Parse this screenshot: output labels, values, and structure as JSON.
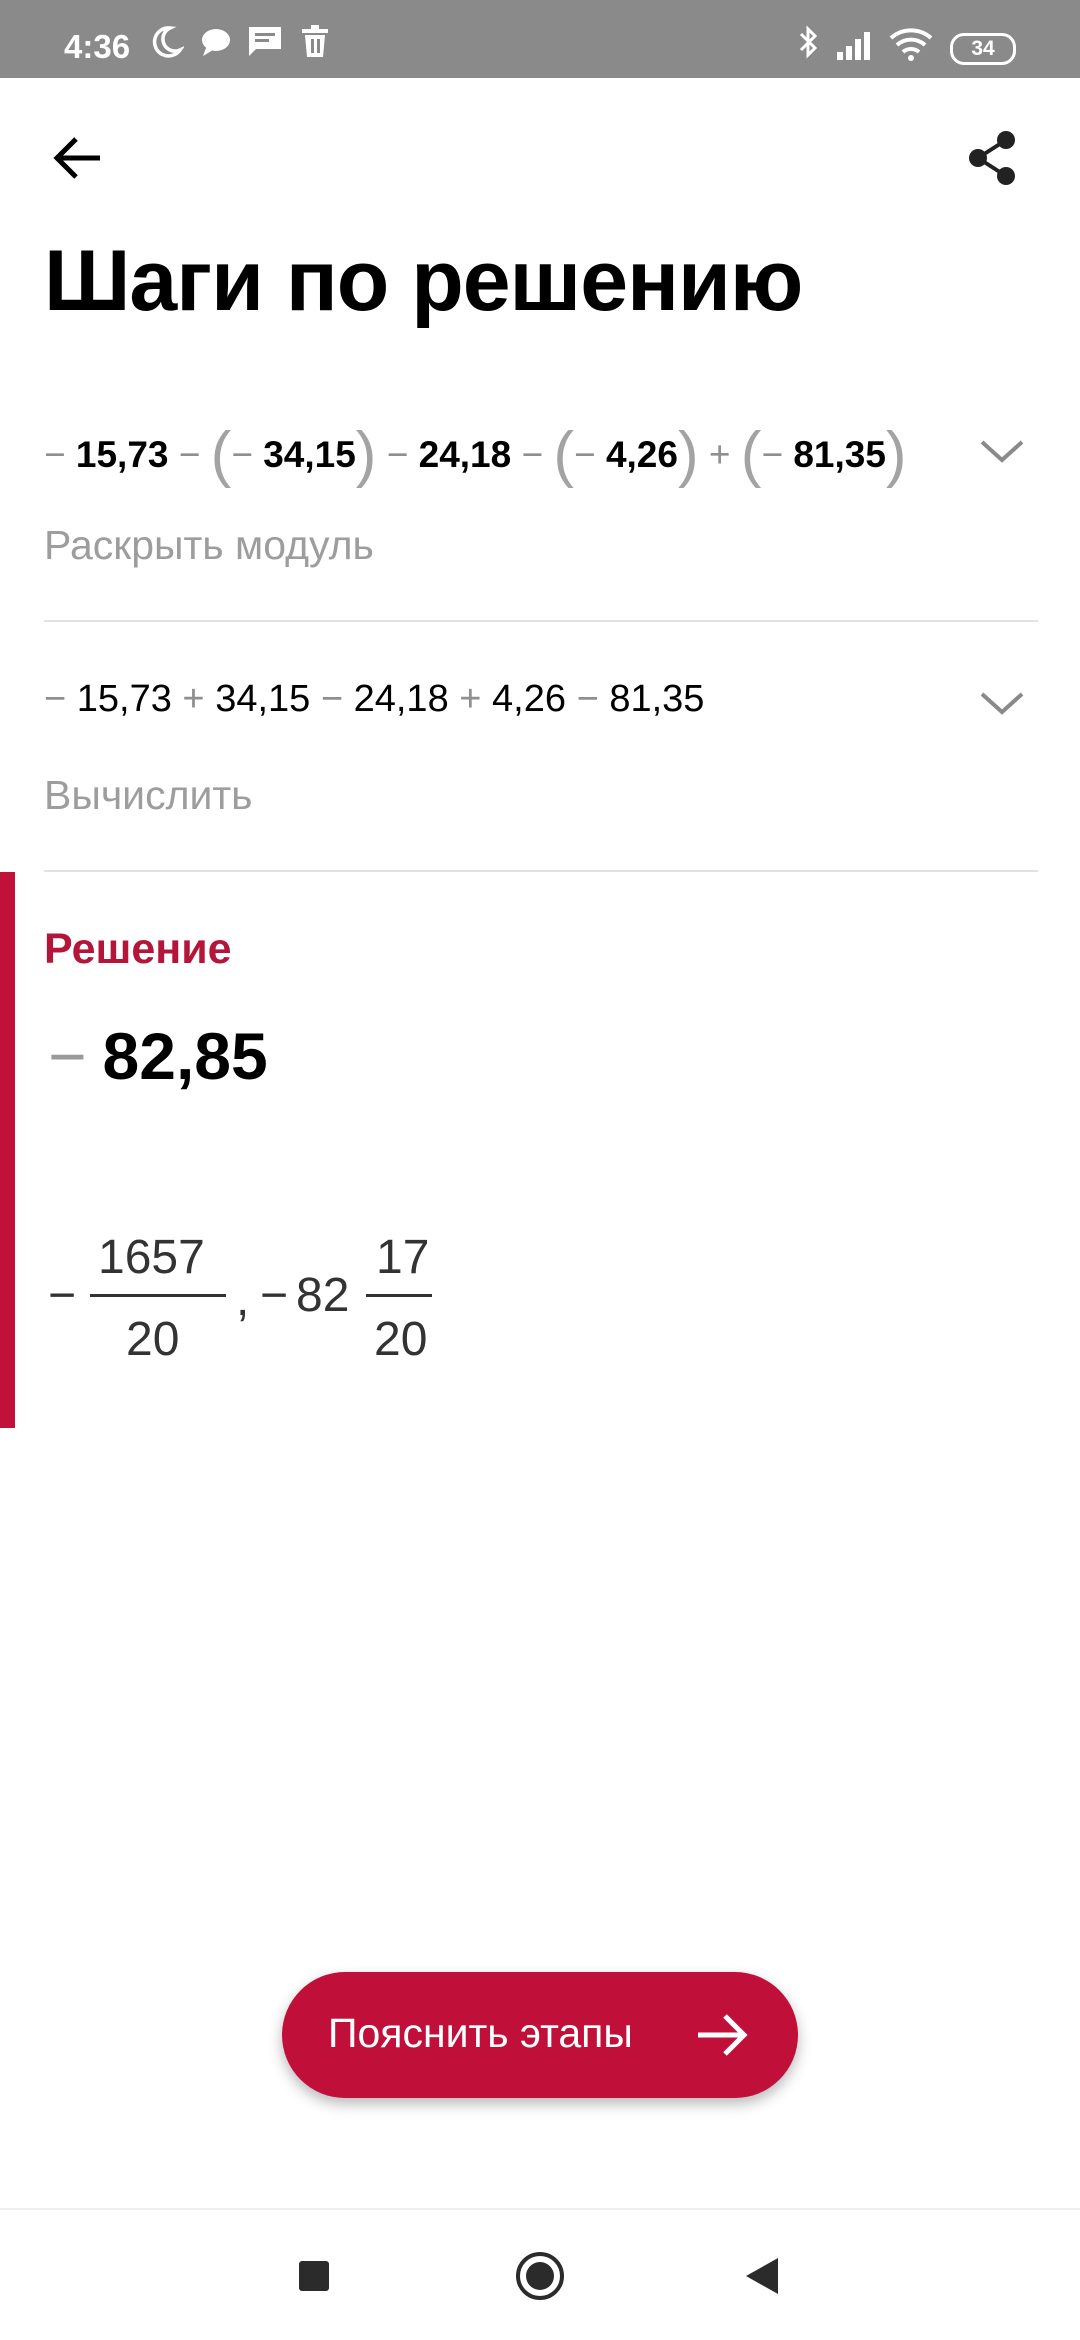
{
  "status_bar": {
    "time": "4:36",
    "battery": "34",
    "left_icons": [
      "moon-icon",
      "chat-bubble-icon",
      "message-icon",
      "trash-icon"
    ],
    "right_icons": [
      "bluetooth-icon",
      "signal-icon",
      "wifi-icon",
      "battery-icon"
    ]
  },
  "header": {
    "title": "Шаги по решению",
    "back_icon": "arrow-back-icon",
    "share_icon": "share-icon"
  },
  "steps": [
    {
      "expression": {
        "t1": "−",
        "t2": "15,73",
        "t3": "−",
        "t4": "(",
        "t5": "−",
        "t6": "34,15",
        "t7": ")",
        "t8": "−",
        "t9": "24,18",
        "t10": "−",
        "t11": "(",
        "t12": "−",
        "t13": "4,26",
        "t14": ")",
        "t15": "+",
        "t16": "(",
        "t17": "−",
        "t18": "81,35",
        "t19": ")"
      },
      "label": "Раскрыть модуль"
    },
    {
      "expression": {
        "t1": "−",
        "t2": "15,73",
        "t3": "+",
        "t4": "34,15",
        "t5": "−",
        "t6": "24,18",
        "t7": "+",
        "t8": "4,26",
        "t9": "−",
        "t10": "81,35"
      },
      "label": "Вычислить"
    }
  ],
  "solution": {
    "title": "Решение",
    "sign": "−",
    "value": "82,85",
    "alt_forms": {
      "minus1": "−",
      "frac1_num": "1657",
      "frac1_den": "20",
      "comma": ",",
      "minus2": "−",
      "whole": "82",
      "frac2_num": "17",
      "frac2_den": "20"
    }
  },
  "explain_button": {
    "label": "Пояснить этапы",
    "icon": "arrow-right-icon"
  },
  "nav_bar": {
    "icons": [
      "recents-square-icon",
      "home-circle-icon",
      "back-triangle-icon"
    ]
  },
  "colors": {
    "accent": "#c0103a",
    "status_bar": "#8a8a8a",
    "muted_text": "#9d9d9d"
  }
}
